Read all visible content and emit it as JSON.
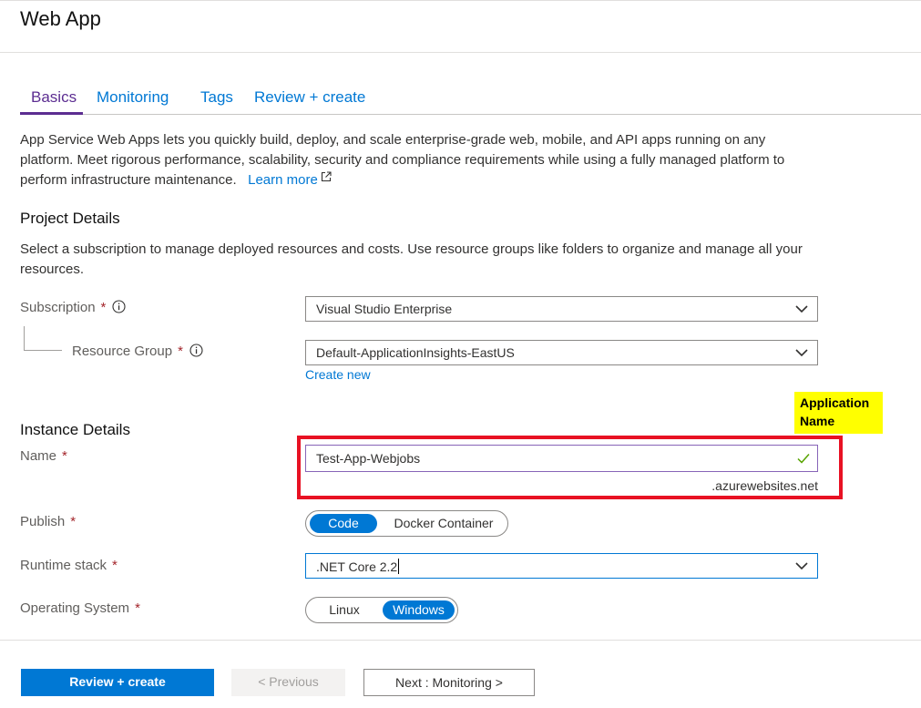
{
  "header": {
    "title": "Web App"
  },
  "tabs": [
    {
      "label": "Basics",
      "active": true
    },
    {
      "label": "Monitoring"
    },
    {
      "label": "Tags"
    },
    {
      "label": "Review + create"
    }
  ],
  "intro": {
    "text": "App Service Web Apps lets you quickly build, deploy, and scale enterprise-grade web, mobile, and API apps running on any platform. Meet rigorous performance, scalability, security and compliance requirements while using a fully managed platform to perform infrastructure maintenance.",
    "learn_more": "Learn more"
  },
  "project_details": {
    "title": "Project Details",
    "description": "Select a subscription to manage deployed resources and costs. Use resource groups like folders to organize and manage all your resources.",
    "subscription": {
      "label": "Subscription",
      "required": "*",
      "value": "Visual Studio Enterprise"
    },
    "resource_group": {
      "label": "Resource Group",
      "required": "*",
      "value": "Default-ApplicationInsights-EastUS",
      "create_new": "Create new"
    }
  },
  "callout": {
    "text": "Application Name"
  },
  "instance_details": {
    "title": "Instance Details",
    "name": {
      "label": "Name",
      "required": "*",
      "value": "Test-App-Webjobs",
      "suffix": ".azurewebsites.net"
    },
    "publish": {
      "label": "Publish",
      "required": "*",
      "options": [
        "Code",
        "Docker Container"
      ],
      "selected": "Code"
    },
    "runtime_stack": {
      "label": "Runtime stack",
      "required": "*",
      "value": ".NET Core 2.2"
    },
    "operating_system": {
      "label": "Operating System",
      "required": "*",
      "options": [
        "Linux",
        "Windows"
      ],
      "selected": "Windows"
    }
  },
  "footer": {
    "review_create": "Review + create",
    "previous": "< Previous",
    "next": "Next : Monitoring >"
  },
  "colors": {
    "accent": "#0078d4",
    "active_tab": "#5c2d91",
    "highlight_box": "#e81123",
    "callout_bg": "#ffff00",
    "valid_check": "#57a300"
  },
  "icons": [
    "info-icon",
    "external-link-icon",
    "chevron-down-icon",
    "checkmark-icon"
  ]
}
